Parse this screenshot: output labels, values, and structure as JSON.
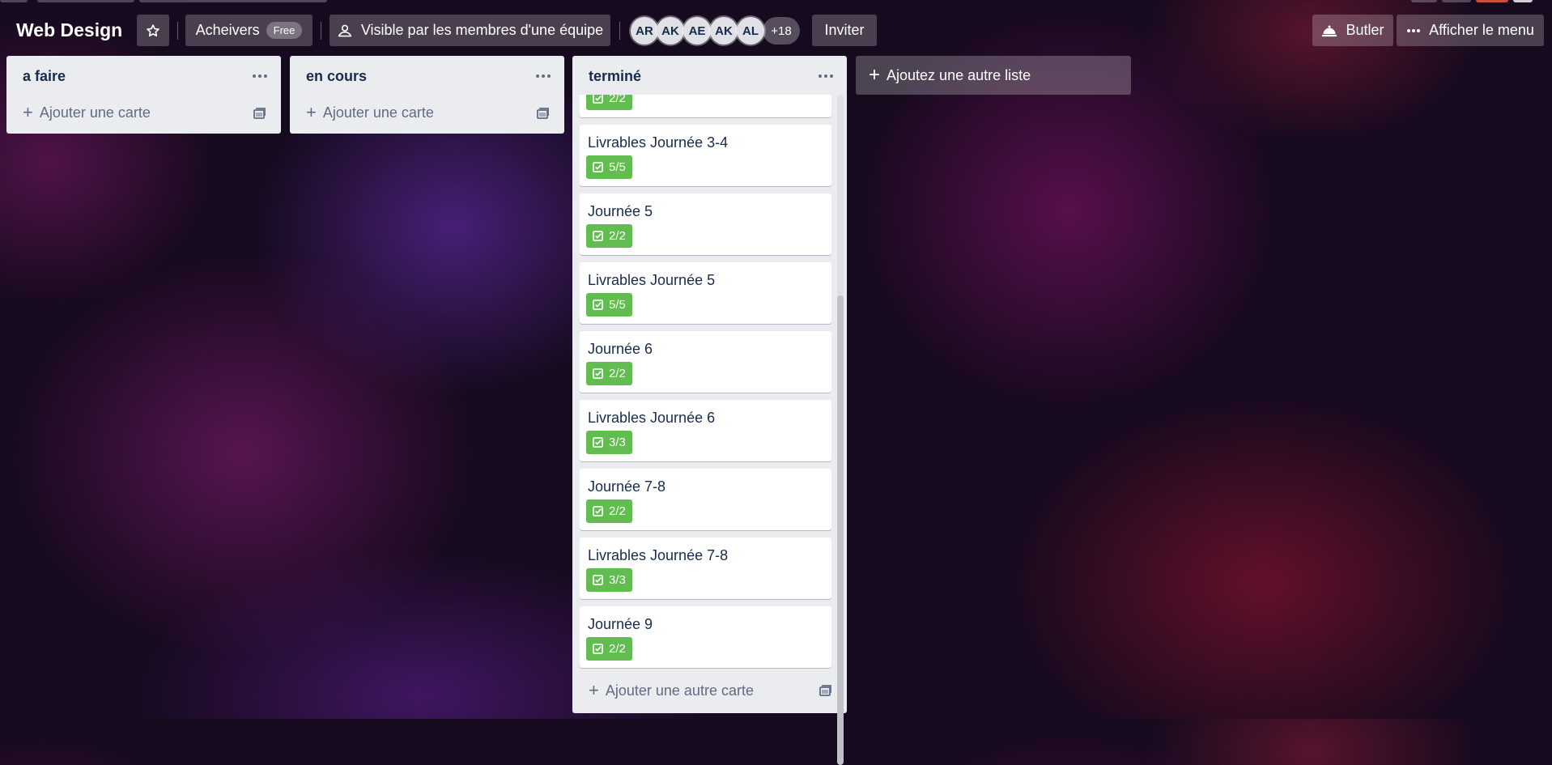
{
  "header": {
    "board_title": "Web Design",
    "workspace_name": "Acheivers",
    "workspace_badge": "Free",
    "visibility_label": "Visible par les membres d'une équipe",
    "members": [
      "AR",
      "AK",
      "AE",
      "AK",
      "AL"
    ],
    "more_members": "+18",
    "invite_label": "Inviter",
    "butler_label": "Butler",
    "menu_label": "Afficher le menu"
  },
  "lists": [
    {
      "title": "a faire",
      "add_card_label": "Ajouter une carte",
      "cards": []
    },
    {
      "title": "en cours",
      "add_card_label": "Ajouter une carte",
      "cards": []
    },
    {
      "title": "terminé",
      "add_card_label": "Ajouter une autre carte",
      "cards": [
        {
          "title": "",
          "checklist": "2/2"
        },
        {
          "title": "Livrables Journée 3-4",
          "checklist": "5/5"
        },
        {
          "title": "Journée 5",
          "checklist": "2/2"
        },
        {
          "title": "Livrables Journée 5",
          "checklist": "5/5"
        },
        {
          "title": "Journée 6",
          "checklist": "2/2"
        },
        {
          "title": "Livrables Journée 6",
          "checklist": "3/3"
        },
        {
          "title": "Journée 7-8",
          "checklist": "2/2"
        },
        {
          "title": "Livrables Journée 7-8",
          "checklist": "3/3"
        },
        {
          "title": "Journée 9",
          "checklist": "2/2"
        }
      ]
    }
  ],
  "add_list_label": "Ajoutez une autre liste",
  "colors": {
    "list_background": "#ebecf0",
    "checklist_complete": "#61bd4f",
    "text_primary": "#172b4d",
    "text_muted": "#5e6c84"
  },
  "icons": {
    "star": "star-icon",
    "visibility": "team-visibility-icon",
    "butler": "butler-bell-icon",
    "menu": "ellipsis-icon",
    "list_menu": "ellipsis-icon",
    "add": "plus-icon",
    "template": "card-template-icon",
    "checklist": "checklist-icon"
  }
}
